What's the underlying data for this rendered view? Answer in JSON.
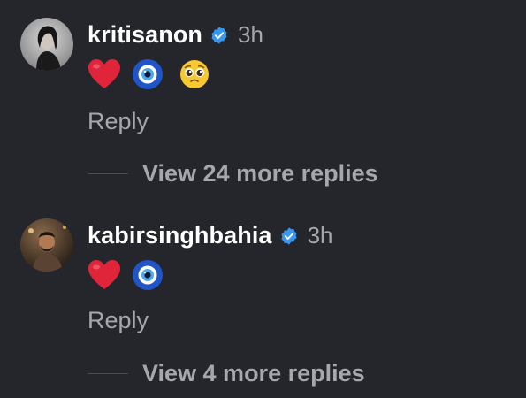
{
  "comments": [
    {
      "username": "kritisanon",
      "time": "3h",
      "emojis": [
        "red-heart",
        "nazar-amulet",
        "pleading-face"
      ],
      "reply_label": "Reply",
      "view_more_label": "View 24 more replies"
    },
    {
      "username": "kabirsinghbahia",
      "time": "3h",
      "emojis": [
        "red-heart",
        "nazar-amulet"
      ],
      "reply_label": "Reply",
      "view_more_label": "View 4 more replies"
    }
  ],
  "colors": {
    "background": "#25262b",
    "muted_text": "#a5a7ad",
    "verified_badge": "#3897f0",
    "heart": "#e0243a"
  }
}
